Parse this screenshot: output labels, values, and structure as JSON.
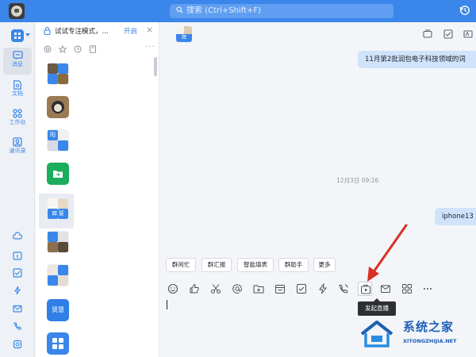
{
  "topbar": {
    "search_placeholder": "搜索 (Ctrl+Shift+F)",
    "accent": "#3a86ea"
  },
  "leftnav": {
    "items": [
      {
        "label": "消息",
        "icon": "chat-bubble-icon",
        "active": true
      },
      {
        "label": "文档",
        "icon": "document-icon",
        "active": false
      },
      {
        "label": "工作台",
        "icon": "workspace-grid-icon",
        "active": false
      },
      {
        "label": "通讯录",
        "icon": "contacts-icon",
        "active": false
      }
    ],
    "bottom_icons": [
      "cloud-icon",
      "calendar-icon",
      "task-check-icon",
      "flash-icon",
      "mail-icon",
      "phone-icon",
      "doc-link-icon"
    ]
  },
  "convlist": {
    "focus_mode_title": "试试专注模式，...",
    "focus_mode_action": "开启",
    "filter_icons": [
      "mention-icon",
      "star-icon",
      "time-icon",
      "doc-icon"
    ],
    "items": [
      {
        "avatar_text": ""
      },
      {
        "avatar_text": ""
      },
      {
        "avatar_text": "阳"
      },
      {
        "avatar_text": ""
      },
      {
        "avatar_text": "辉 慧"
      },
      {
        "avatar_text": ""
      },
      {
        "avatar_text": ""
      },
      {
        "avatar_text": "贤慧"
      },
      {
        "avatar_text": ""
      }
    ]
  },
  "chat": {
    "group_avatar_text": "辉",
    "messages": [
      {
        "text": "11月第2批润包电子科技领域的词",
        "side": "right"
      },
      {
        "text": "iphone13",
        "side": "right"
      }
    ],
    "timestamp": "12月3日 09:26",
    "quick_buttons": [
      "群闲忙",
      "群汇报",
      "智能填表",
      "群助手",
      "更多"
    ],
    "toolbar_icons": [
      "emoji-icon",
      "thumbs-up-icon",
      "scissors-icon",
      "at-icon",
      "add-folder-icon",
      "calendar-icon",
      "task-check-icon",
      "flash-icon",
      "call-icon",
      "live-stream-icon",
      "mail-icon",
      "apps-icon",
      "more-icon"
    ],
    "tooltip": "发起直播",
    "annotation_arrow_color": "#d93025"
  },
  "watermark": {
    "title": "系统之家",
    "subtitle": "XITONGZHIJIA.NET"
  }
}
